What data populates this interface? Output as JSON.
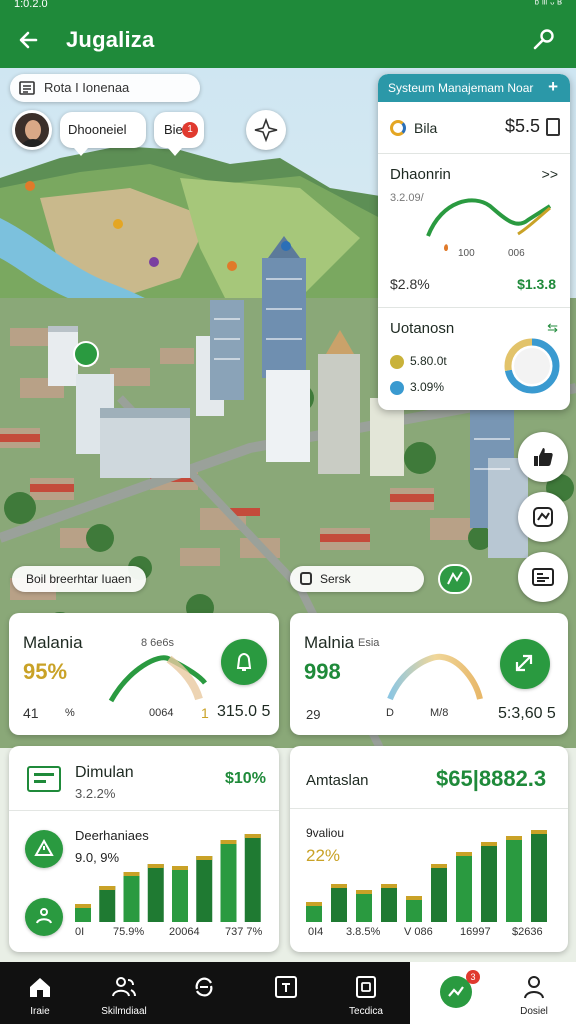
{
  "status_bar": {
    "time": "1:0.2.0",
    "system": "ᵇ ᶦᶦᶦ ᵕ ᴮ"
  },
  "app_bar": {
    "title": "Jugaliza"
  },
  "map": {
    "route_label": "Rota I Ionenaa",
    "user_label": "Dhooneiel",
    "alert_label": "Biel",
    "alert_count": "1",
    "legend_label": "Boil breerhtar Iuaen",
    "search_label": "Sersk"
  },
  "system_panel": {
    "title": "Systeum Manajemam Noar",
    "row1": {
      "label": "Bila",
      "value": "$5.5"
    },
    "sec2": {
      "title": "Dhaonrin",
      "arrows": ">>",
      "subtitle": "3.2.09/",
      "tick1": "100",
      "tick2": "006",
      "bottom_left": "$2.8%",
      "bottom_right": "$1.3.8"
    },
    "sec3": {
      "title": "Uotanosn",
      "icon": "⇆",
      "row1": "5.80.0t",
      "row2": "3.09%",
      "donut": [
        0.72,
        0.28
      ]
    }
  },
  "cards": {
    "c1": {
      "title": "Malania",
      "value": "95%",
      "sub_label": "8 6e6s",
      "t1": "41",
      "t2": "%",
      "t3": "0064",
      "t4": "1",
      "total": "315.0 5"
    },
    "c2": {
      "title": "Malnia",
      "title2": "Esia",
      "value": "998",
      "t1": "29",
      "t2": "D",
      "t3": "M/8",
      "total": "5:3,60 5"
    },
    "c3": {
      "title": "Dimulan",
      "sub": "3.2.2%",
      "value": "$10%",
      "label2": "Deerhaniaes",
      "value2": "9.0, 9%",
      "x_labels": [
        "0I",
        "75.9%",
        "20064",
        "737 7%"
      ]
    },
    "c4": {
      "title": "Amtaslan",
      "value": "$65|8882.3",
      "label2": "9valiou",
      "value2": "22%",
      "x_labels": [
        "0I4",
        "3.8.5%",
        "V 086",
        "16997",
        "$2636"
      ]
    }
  },
  "chart_data": [
    {
      "type": "bar",
      "title": "Dimulan",
      "x_labels": [
        "0I",
        "75.9%",
        "20064",
        "737 7%"
      ],
      "series": [
        {
          "values": [
            0.18,
            0.36,
            0.5,
            0.58,
            0.56,
            0.66,
            0.82,
            0.88
          ]
        }
      ]
    },
    {
      "type": "bar",
      "title": "Amtaslan",
      "x_labels": [
        "0I4",
        "3.8.5%",
        "V 086",
        "16997",
        "$2636"
      ],
      "series": [
        {
          "values": [
            0.2,
            0.38,
            0.32,
            0.38,
            0.26,
            0.58,
            0.7,
            0.8,
            0.86,
            0.92
          ]
        }
      ]
    }
  ],
  "bottom_nav": {
    "items": [
      "Iraie",
      "Skilmdiaal",
      "",
      "",
      "Tecdica"
    ],
    "badge": "3",
    "account_label": "Dosiel"
  },
  "colors": {
    "primary": "#1f8a3a",
    "accent_teal": "#2b98a8",
    "gold": "#c9a227"
  }
}
